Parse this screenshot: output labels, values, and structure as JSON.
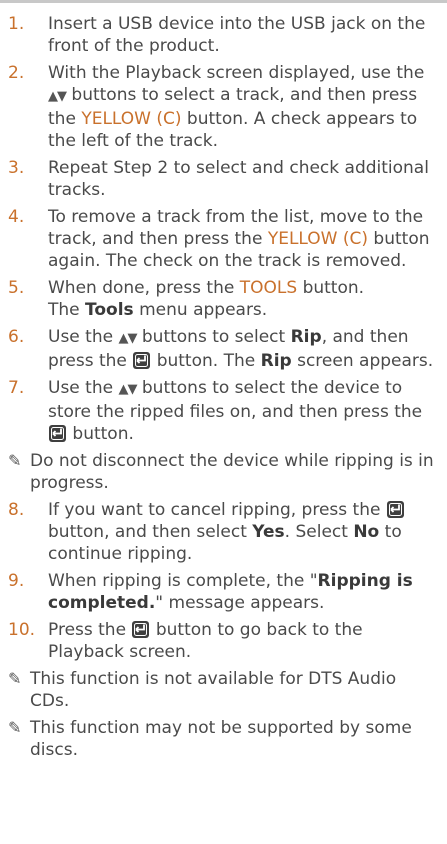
{
  "steps": [
    {
      "num": "1.",
      "parts": [
        {
          "t": "Insert a USB device into the USB jack on the front of the product."
        }
      ]
    },
    {
      "num": "2.",
      "parts": [
        {
          "t": "With the Playback screen displayed, use the "
        },
        {
          "arrows": "▲▼"
        },
        {
          "t": " buttons to select a track, and then press the "
        },
        {
          "o": "YELLOW (C)"
        },
        {
          "t": " button. A check appears to the left of the track."
        }
      ]
    },
    {
      "num": "3.",
      "parts": [
        {
          "t": "Repeat Step 2 to select and check additional tracks."
        }
      ]
    },
    {
      "num": "4.",
      "parts": [
        {
          "t": "To remove a track from the list, move to the track, and then press the "
        },
        {
          "o": "YELLOW (C)"
        },
        {
          "t": " button again. The check on the track is removed."
        }
      ]
    },
    {
      "num": "5.",
      "parts": [
        {
          "t": "When done, press the "
        },
        {
          "o": "TOOLS"
        },
        {
          "t": " button."
        },
        {
          "br": true
        },
        {
          "t": "The "
        },
        {
          "b": "Tools"
        },
        {
          "t": " menu appears."
        }
      ]
    },
    {
      "num": "6.",
      "parts": [
        {
          "t": "Use the "
        },
        {
          "arrows": "▲▼"
        },
        {
          "t": " buttons to select "
        },
        {
          "b": "Rip"
        },
        {
          "t": ", and then press the "
        },
        {
          "icon": "enter-icon"
        },
        {
          "t": " button. The "
        },
        {
          "b": "Rip"
        },
        {
          "t": " screen appears."
        }
      ]
    },
    {
      "num": "7.",
      "parts": [
        {
          "t": "Use the "
        },
        {
          "arrows": "▲▼"
        },
        {
          "t": " buttons to select the device to store the ripped files on, and then press the "
        },
        {
          "icon": "enter-icon"
        },
        {
          "t": " button."
        }
      ]
    },
    {
      "note": "Do not disconnect the device while ripping is in progress."
    },
    {
      "num": "8.",
      "parts": [
        {
          "t": "If you want to cancel ripping, press the "
        },
        {
          "icon": "enter-icon"
        },
        {
          "t": " button, and then select "
        },
        {
          "b": "Yes"
        },
        {
          "t": ". Select "
        },
        {
          "b": "No"
        },
        {
          "t": " to continue ripping."
        }
      ]
    },
    {
      "num": "9.",
      "parts": [
        {
          "t": "When ripping is complete, the \""
        },
        {
          "b": "Ripping is completed."
        },
        {
          "t": "\" message appears."
        }
      ]
    },
    {
      "num": "10.",
      "parts": [
        {
          "t": "Press the "
        },
        {
          "icon": "enter-icon"
        },
        {
          "t": " button to go back to the Playback screen."
        }
      ]
    },
    {
      "note": "This function is not available for DTS Audio CDs."
    },
    {
      "note": "This function may not be supported by some discs."
    }
  ],
  "note_glyph": "✎"
}
